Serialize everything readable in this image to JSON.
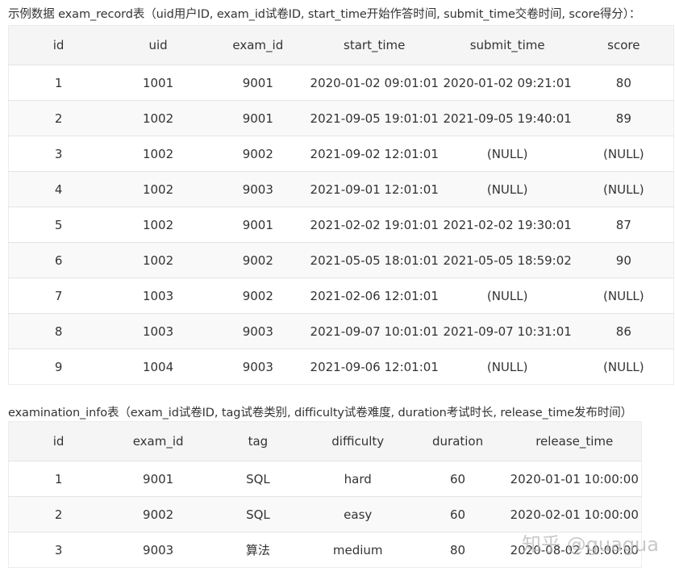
{
  "exam_record": {
    "caption": "示例数据 exam_record表（uid用户ID, exam_id试卷ID, start_time开始作答时间, submit_time交卷时间, score得分）：",
    "columns": [
      "id",
      "uid",
      "exam_id",
      "start_time",
      "submit_time",
      "score"
    ],
    "rows": [
      [
        "1",
        "1001",
        "9001",
        "2020-01-02 09:01:01",
        "2020-01-02 09:21:01",
        "80"
      ],
      [
        "2",
        "1002",
        "9001",
        "2021-09-05 19:01:01",
        "2021-09-05 19:40:01",
        "89"
      ],
      [
        "3",
        "1002",
        "9002",
        "2021-09-02 12:01:01",
        "(NULL)",
        "(NULL)"
      ],
      [
        "4",
        "1002",
        "9003",
        "2021-09-01 12:01:01",
        "(NULL)",
        "(NULL)"
      ],
      [
        "5",
        "1002",
        "9001",
        "2021-02-02 19:01:01",
        "2021-02-02 19:30:01",
        "87"
      ],
      [
        "6",
        "1002",
        "9002",
        "2021-05-05 18:01:01",
        "2021-05-05 18:59:02",
        "90"
      ],
      [
        "7",
        "1003",
        "9002",
        "2021-02-06 12:01:01",
        "(NULL)",
        "(NULL)"
      ],
      [
        "8",
        "1003",
        "9003",
        "2021-09-07 10:01:01",
        "2021-09-07 10:31:01",
        "86"
      ],
      [
        "9",
        "1004",
        "9003",
        "2021-09-06 12:01:01",
        "(NULL)",
        "(NULL)"
      ]
    ]
  },
  "examination_info": {
    "caption": "examination_info表（exam_id试卷ID, tag试卷类别, difficulty试卷难度, duration考试时长, release_time发布时间）",
    "columns": [
      "id",
      "exam_id",
      "tag",
      "difficulty",
      "duration",
      "release_time"
    ],
    "rows": [
      [
        "1",
        "9001",
        "SQL",
        "hard",
        "60",
        "2020-01-01 10:00:00"
      ],
      [
        "2",
        "9002",
        "SQL",
        "easy",
        "60",
        "2020-02-01 10:00:00"
      ],
      [
        "3",
        "9003",
        "算法",
        "medium",
        "80",
        "2020-08-02 10:00:00"
      ]
    ]
  },
  "watermark": "知乎 @guagua"
}
